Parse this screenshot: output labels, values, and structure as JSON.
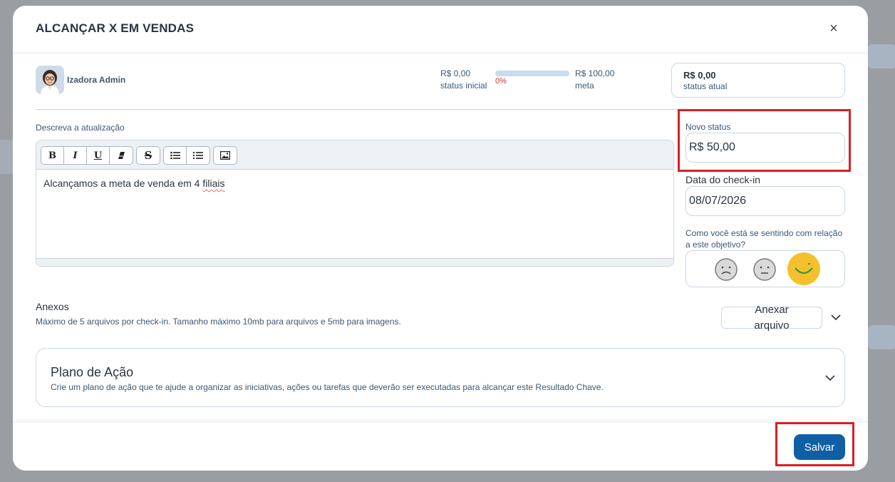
{
  "modal": {
    "title": "ALCANÇAR X EM VENDAS",
    "close_label": "×"
  },
  "user": {
    "name": "Izadora Admin"
  },
  "progress": {
    "initial_value": "R$ 0,00",
    "initial_label": "status inicial",
    "percent_label": "0%",
    "fill_fraction": 0.0,
    "goal_value": "R$ 100,00",
    "goal_label": "meta"
  },
  "current_status": {
    "value": "R$ 0,00",
    "label": "status atual"
  },
  "description": {
    "label": "Descreva a atualização",
    "text_before": "Alcançamos a meta de venda em 4 ",
    "text_misspelled": "filiais",
    "toolbar": [
      {
        "group": [
          "bold",
          "italic",
          "underline",
          "eraser"
        ]
      },
      {
        "group": [
          "strikethrough"
        ]
      },
      {
        "group": [
          "bullet-list",
          "numbered-list"
        ]
      },
      {
        "group": [
          "image"
        ]
      }
    ]
  },
  "new_status": {
    "label": "Novo status",
    "value": "R$ 50,00"
  },
  "checkin_date": {
    "label": "Data do check-in",
    "value": "08/07/2026"
  },
  "feeling": {
    "label": "Como você está se sentindo com relação a este objetivo?",
    "options": [
      "sad-face-icon",
      "neutral-face-icon",
      "happy-face-icon"
    ],
    "selected": "happy-face-icon"
  },
  "attachments": {
    "title": "Anexos",
    "subtitle": "Máximo de 5 arquivos por check-in. Tamanho máximo 10mb para arquivos e 5mb para imagens.",
    "button_label": "Anexar arquivo"
  },
  "action_plan": {
    "title": "Plano de Ação",
    "subtitle": "Crie um plano de ação que te ajude a organizar as iniciativas, ações ou tarefas que deverão ser executadas para alcançar este Resultado Chave."
  },
  "footer": {
    "save_label": "Salvar"
  },
  "colors": {
    "primary": "#0f5fa6",
    "highlight": "#d81f26",
    "progress_track": "#c8dcef",
    "happy": "#f5c02c"
  }
}
